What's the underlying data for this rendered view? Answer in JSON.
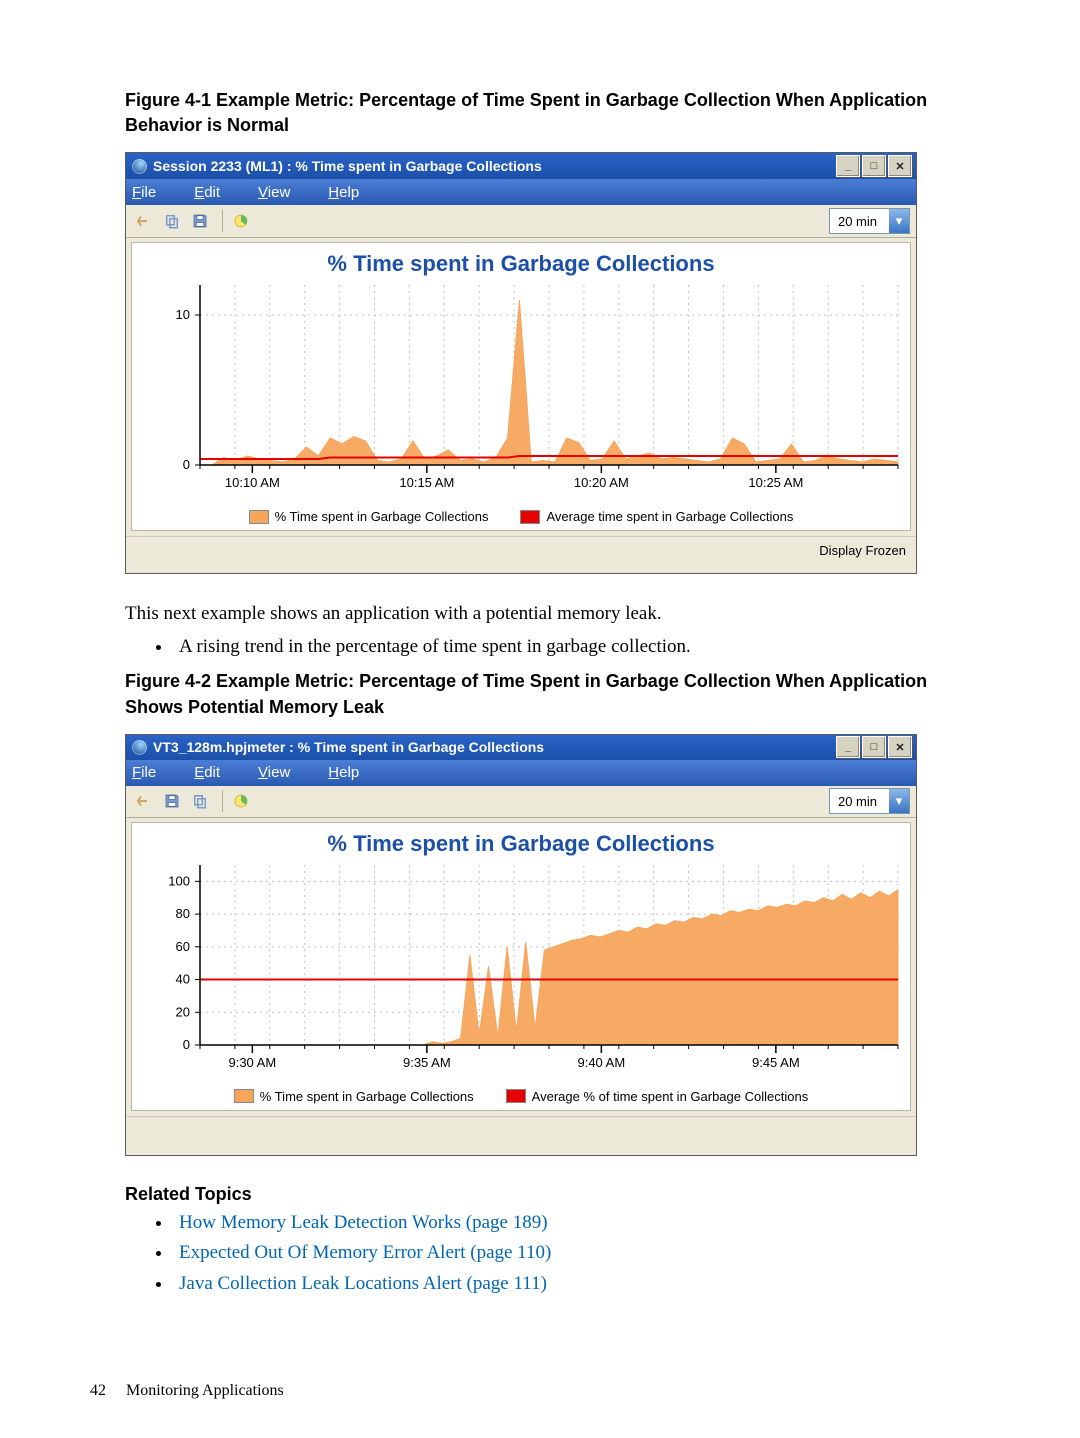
{
  "page": {
    "number": "42",
    "section": "Monitoring Applications"
  },
  "caption1": "Figure 4-1 Example Metric: Percentage of Time Spent in Garbage Collection When Application Behavior is Normal",
  "body_text": "This next example shows an application with a potential memory leak.",
  "body_bullet": "A rising trend in the percentage of time spent in garbage collection.",
  "caption2": "Figure 4-2 Example Metric: Percentage of Time Spent in Garbage Collection When Application Shows Potential Memory Leak",
  "related_heading": "Related Topics",
  "related_links": [
    "How Memory Leak Detection Works (page 189)",
    "Expected Out Of Memory Error Alert (page 110)",
    "Java Collection Leak Locations Alert (page 111)"
  ],
  "win1": {
    "title": "Session 2233 (ML1) : % Time spent in Garbage Collections",
    "menu": {
      "file": "File",
      "edit": "Edit",
      "view": "View",
      "help": "Help"
    },
    "range": "20 min",
    "chart_title": "% Time spent in Garbage Collections",
    "legend1": "% Time spent in Garbage Collections",
    "legend2": "Average time spent in Garbage Collections",
    "status": "Display Frozen"
  },
  "win2": {
    "title": "VT3_128m.hpjmeter : % Time spent in Garbage Collections",
    "menu": {
      "file": "File",
      "edit": "Edit",
      "view": "View",
      "help": "Help"
    },
    "range": "20 min",
    "chart_title": "% Time spent in Garbage Collections",
    "legend1": "% Time spent in Garbage Collections",
    "legend2": "Average % of time spent in Garbage Collections"
  },
  "chart_data": [
    {
      "type": "area",
      "title": "% Time spent in Garbage Collections",
      "xlabel": "",
      "ylabel": "",
      "ylim": [
        0,
        12
      ],
      "yticks": [
        0,
        10
      ],
      "xticks": [
        "10:10 AM",
        "10:15 AM",
        "10:20 AM",
        "10:25 AM"
      ],
      "x": [
        0,
        1,
        2,
        3,
        4,
        5,
        6,
        7,
        8,
        9,
        10,
        11,
        12,
        13,
        14,
        15,
        16,
        17,
        18,
        19,
        20,
        21,
        22,
        23,
        24,
        25,
        26,
        27,
        28,
        29,
        30,
        31,
        32,
        33,
        34,
        35,
        36,
        37,
        38,
        39,
        40,
        41,
        42,
        43,
        44,
        45,
        46,
        47,
        48,
        49,
        50,
        51,
        52,
        53,
        54,
        55,
        56,
        57,
        58,
        59
      ],
      "series": [
        {
          "name": "% Time spent in Garbage Collections",
          "color": "#f6a55c",
          "values": [
            0,
            0,
            0.5,
            0.3,
            0.6,
            0.4,
            0.3,
            0.2,
            0.4,
            1.2,
            0.6,
            1.8,
            1.4,
            1.9,
            1.6,
            0.3,
            0.2,
            0.4,
            1.6,
            0.4,
            0.6,
            1.0,
            0.3,
            0.4,
            0.2,
            0.5,
            1.8,
            11.0,
            0.2,
            0.3,
            0.2,
            1.8,
            1.5,
            0.3,
            0.4,
            1.6,
            0.4,
            0.6,
            0.8,
            0.4,
            0.5,
            0.4,
            0.3,
            0.2,
            0.4,
            1.8,
            1.4,
            0.2,
            0.3,
            0.4,
            1.4,
            0.2,
            0.3,
            0.6,
            0.4,
            0.3,
            0.2,
            0.4,
            0.3,
            0.2
          ]
        },
        {
          "name": "Average time spent in Garbage Collections",
          "color": "#e60000",
          "values": [
            0.4,
            0.4,
            0.4,
            0.4,
            0.4,
            0.4,
            0.4,
            0.4,
            0.4,
            0.4,
            0.4,
            0.5,
            0.5,
            0.5,
            0.5,
            0.5,
            0.5,
            0.5,
            0.5,
            0.5,
            0.5,
            0.5,
            0.5,
            0.5,
            0.5,
            0.5,
            0.5,
            0.6,
            0.6,
            0.6,
            0.6,
            0.6,
            0.6,
            0.6,
            0.6,
            0.6,
            0.6,
            0.6,
            0.6,
            0.6,
            0.6,
            0.6,
            0.6,
            0.6,
            0.6,
            0.6,
            0.6,
            0.6,
            0.6,
            0.6,
            0.6,
            0.6,
            0.6,
            0.6,
            0.6,
            0.6,
            0.6,
            0.6,
            0.6,
            0.6
          ]
        }
      ]
    },
    {
      "type": "area",
      "title": "% Time spent in Garbage Collections",
      "xlabel": "",
      "ylabel": "",
      "ylim": [
        0,
        110
      ],
      "yticks": [
        0,
        20,
        40,
        60,
        80,
        100
      ],
      "xticks": [
        "9:30 AM",
        "9:35 AM",
        "9:40 AM",
        "9:45 AM"
      ],
      "x": [
        0,
        1,
        2,
        3,
        4,
        5,
        6,
        7,
        8,
        9,
        10,
        11,
        12,
        13,
        14,
        15,
        16,
        17,
        18,
        19,
        20,
        21,
        22,
        23,
        24,
        25,
        26,
        27,
        28,
        29,
        30,
        31,
        32,
        33,
        34,
        35,
        36,
        37,
        38,
        39,
        40,
        41,
        42,
        43,
        44,
        45,
        46,
        47,
        48,
        49,
        50,
        51,
        52,
        53,
        54,
        55,
        56,
        57,
        58,
        59,
        60,
        61,
        62,
        63,
        64,
        65,
        66,
        67,
        68,
        69,
        70,
        71,
        72,
        73,
        74,
        75
      ],
      "series": [
        {
          "name": "% Time spent in Garbage Collections",
          "color": "#f6a55c",
          "values": [
            0,
            0,
            0,
            0,
            0,
            0,
            0,
            0,
            0,
            0,
            0,
            0,
            0,
            0,
            0,
            0,
            0,
            0,
            0,
            0,
            0,
            0,
            0,
            0,
            0,
            2,
            1,
            2,
            4,
            55,
            6,
            48,
            5,
            60,
            8,
            63,
            10,
            58,
            60,
            62,
            64,
            65,
            67,
            66,
            68,
            70,
            69,
            72,
            71,
            74,
            73,
            76,
            75,
            78,
            77,
            80,
            79,
            82,
            81,
            83,
            82,
            85,
            84,
            86,
            85,
            88,
            87,
            90,
            88,
            92,
            89,
            93,
            90,
            94,
            91,
            95
          ]
        },
        {
          "name": "Average % of time spent in Garbage Collections",
          "color": "#e60000",
          "values": [
            40,
            40,
            40,
            40,
            40,
            40,
            40,
            40,
            40,
            40,
            40,
            40,
            40,
            40,
            40,
            40,
            40,
            40,
            40,
            40,
            40,
            40,
            40,
            40,
            40,
            40,
            40,
            40,
            40,
            40,
            40,
            40,
            40,
            40,
            40,
            40,
            40,
            40,
            40,
            40,
            40,
            40,
            40,
            40,
            40,
            40,
            40,
            40,
            40,
            40,
            40,
            40,
            40,
            40,
            40,
            40,
            40,
            40,
            40,
            40,
            40,
            40,
            40,
            40,
            40,
            40,
            40,
            40,
            40,
            40,
            40,
            40,
            40,
            40,
            40,
            40
          ]
        }
      ]
    }
  ]
}
